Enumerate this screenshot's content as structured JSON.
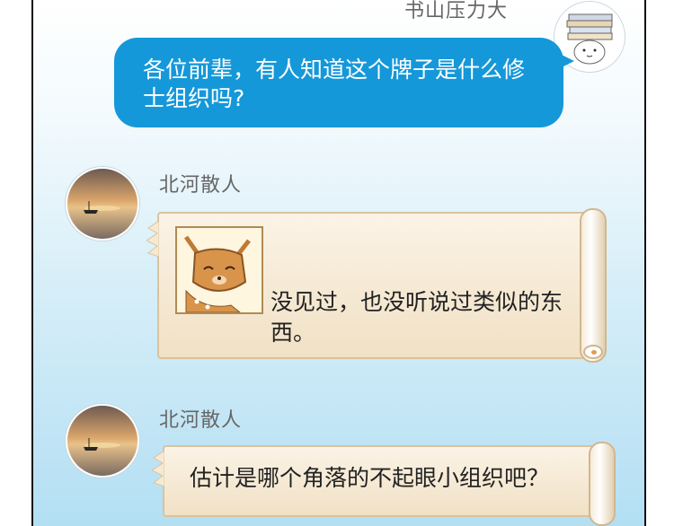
{
  "colors": {
    "bubble_blue": "#1598d9",
    "scroll_bg": "#f6e9d3",
    "bg_bottom": "#b3dff3"
  },
  "messages": [
    {
      "sender": "书山压力大",
      "text": "各位前辈，有人知道这个牌子是什么修士组织吗?"
    },
    {
      "sender": "北河散人",
      "text": "没见过，也没听说过类似的东西。",
      "sticker": "deer-sticker"
    },
    {
      "sender": "北河散人",
      "text": "估计是哪个角落的不起眼小组织吧？"
    }
  ]
}
